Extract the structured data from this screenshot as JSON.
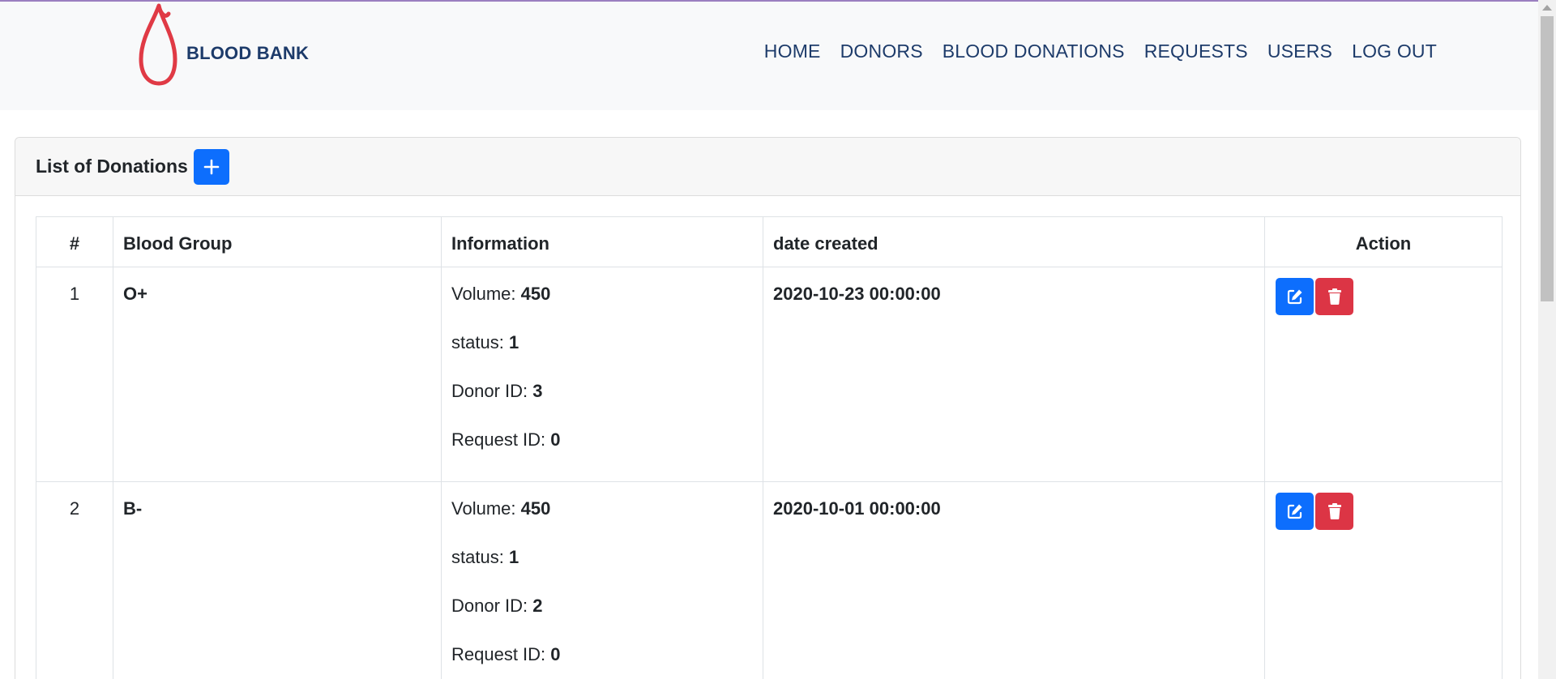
{
  "brand": {
    "name": "BLOOD BANK",
    "logo": "blood-drop-logo"
  },
  "nav": {
    "items": [
      "HOME",
      "DONORS",
      "BLOOD DONATIONS",
      "REQUESTS",
      "USERS",
      "LOG OUT"
    ]
  },
  "card": {
    "title": "List of Donations",
    "add_icon": "plus-icon"
  },
  "table": {
    "headers": [
      "#",
      "Blood Group",
      "Information",
      "date created",
      "Action"
    ],
    "info_labels": {
      "volume": "Volume:",
      "status": "status:",
      "donor_id": "Donor ID:",
      "request_id": "Request ID:"
    },
    "rows": [
      {
        "num": "1",
        "blood_group": "O+",
        "volume": "450",
        "status": "1",
        "donor_id": "3",
        "request_id": "0",
        "date_created": "2020-10-23 00:00:00"
      },
      {
        "num": "2",
        "blood_group": "B-",
        "volume": "450",
        "status": "1",
        "donor_id": "2",
        "request_id": "0",
        "date_created": "2020-10-01 00:00:00"
      }
    ]
  },
  "colors": {
    "primary": "#0d6efd",
    "danger": "#dc3545",
    "brand_text": "#1d3b6a",
    "logo_red": "#e03a45",
    "navbar_bg": "#f8f9fa"
  }
}
